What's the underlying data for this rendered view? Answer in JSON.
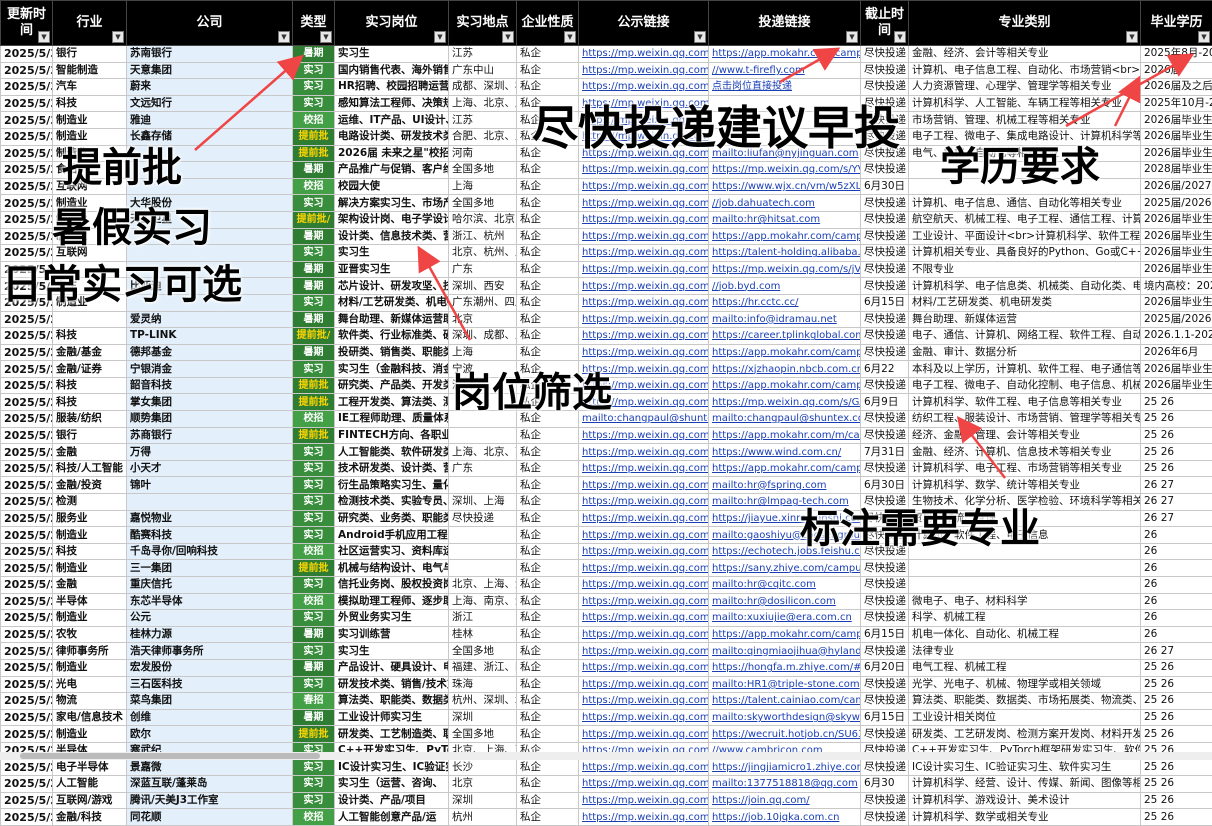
{
  "headers": [
    "更新时间",
    "行业",
    "公司",
    "类型",
    "实习岗位",
    "实习地点",
    "企业性质",
    "公示链接",
    "投递链接",
    "截止时间",
    "专业类别",
    "毕业学历"
  ],
  "colors": {
    "header_bg": "#000000",
    "type_bg": "#2e7d32",
    "tiqian_text": "#ffd600",
    "link": "#1a3fb5",
    "arrow": "#f04545"
  },
  "rows": [
    [
      "2025/5/30",
      "银行",
      "苏南银行",
      "暑期",
      "实习生",
      "江苏",
      "私企",
      "https://mp.weixin.qq.com/s/EK8",
      "https://app.mokahr.com/campus-r",
      "尽快投递",
      "金融、经济、会计等相关专业",
      "2025年8月-2026"
    ],
    [
      "2025/5/30",
      "智能制造",
      "天意集团",
      "实习",
      "国内销售代表、海外销售代",
      "广东中山",
      "私企",
      "https://mp.weixin.qq.com/s/zCO",
      "//www.t-firefly.com",
      "尽快投递",
      "计算机、电子信息工程、自动化、市场营销<br>平面设",
      "2026届"
    ],
    [
      "2025/5/30",
      "汽车",
      "蔚来",
      "实习",
      "HR招聘、校园招聘运营、盾",
      "成都、深圳、杭",
      "私企",
      "https://mp.weixin.qq.com/s/fpR",
      "点击岗位直接投递",
      "尽快投递",
      "人力资源管理、心理学、管理学等相关专业",
      "2026届及之后毕"
    ],
    [
      "2025/5/30",
      "科技",
      "文远知行",
      "实习",
      "感知算法工程师、决策规划算",
      "上海、北京、广",
      "私企",
      "https://mp.weixin.qq.com/s/sRtl",
      "",
      "尽快投递",
      "计算机科学、人工智能、车辆工程等相关专业",
      "2025年10月-2026"
    ],
    [
      "2025/5/30",
      "制造业",
      "雅迪",
      "校招",
      "运维、IT产品、UI设计、SAP",
      "江苏",
      "私企",
      "https://mp.weixin.qq.com/s/vt8C",
      "",
      "尽快投递",
      "市场营销、管理、机械工程等相关专业",
      "2026届毕业生"
    ],
    [
      "2025/5/30",
      "制造业",
      "长鑫存储",
      "提前批",
      "电路设计类、研发技术类、",
      "合肥、北京、上",
      "私企",
      "https://mp.weixin.qq.com/s/Qv2",
      "",
      "尽快投递",
      "电子工程、微电子、集成电路设计、计算机科学等相关专",
      "2026届毕业生"
    ],
    [
      "2025/5/30",
      "制造业",
      "",
      "提前批",
      "2026届 未来之星\"校招",
      "河南",
      "私企",
      "https://mp.weixin.qq.com/s/8",
      "mailto:liufan@nyjinguan.com",
      "尽快投递",
      "电气、机械、自动化等相关专业",
      "2026届毕业生"
    ],
    [
      "2025/5/30",
      "食品",
      "",
      "暑期",
      "产品推广与促销、客户维",
      "全国多地",
      "私企",
      "https://mp.weixin.qq.com/s/Y",
      "https://mp.weixin.qq.com/s/YVXEg",
      "尽快投递",
      "",
      "2028届毕业生"
    ],
    [
      "2025/5/30",
      "互联网",
      "",
      "校招",
      "校园大使",
      "上海",
      "私企",
      "https://mp.weixin.qq.com/s/",
      "https://www.wjx.cn/vm/w5zXLPj.as",
      "6月30日",
      "",
      "2026届/2027届"
    ],
    [
      "2025/5/30",
      "制造业",
      "大华股份",
      "实习",
      "解决方案实习生、市场产品实",
      "全国多地",
      "私企",
      "https://mp.weixin.qq.com/s/a",
      "//job.dahuatech.com",
      "尽快投递",
      "计算机、电子信息、通信、自动化等相关专业",
      "2025届/2026届"
    ],
    [
      "2025/5/30",
      "制造业",
      "天工卫星",
      "提前批/",
      "架构设计岗、电子学设计岗、",
      "哈尔滨、北京",
      "私企",
      "https://mp.weixin.qq.com/s/F",
      "mailto:hr@hitsat.com",
      "尽快投递",
      "航空航天、机械工程、电子工程、通信工程、计算机科学",
      "2026届毕业生"
    ],
    [
      "2025/5/30",
      "制造业",
      "",
      "暑期",
      "设计类、信息技术类、营销",
      "浙江、杭州",
      "私企",
      "https://mp.weixin.qq.com/s/F",
      "https://app.mokahr.com/campus-r",
      "尽快投递",
      "工业设计、平面设计<br>计算机科学、软件工程、电子信",
      "2026届毕业生"
    ],
    [
      "2025/5/29",
      "互联网",
      "",
      "实习",
      "实习生",
      "北京、杭州、上",
      "私企",
      "https://mp.weixin.qq.com/s/TBa",
      "https://talent-holding.alibaba.com/",
      "尽快投递",
      "计算机相关专业、具备良好的Python、Go或C++编程能",
      "2026届毕业生"
    ],
    [
      "2025/5/29",
      "",
      "",
      "暑期",
      "亚晋实习生",
      "广东",
      "私企",
      "https://mp.weixin.qq.com/s/jVzT",
      "https://mp.weixin.qq.com/s/jVzTEl4lG",
      "尽快投递",
      "不限专业",
      "2026届毕业生"
    ],
    [
      "2025/5/28",
      "汽车",
      "比亚迪",
      "暑期",
      "芯片设计、研发攻坚、技术支",
      "深圳、西安",
      "私企",
      "https://mp.weixin.qq.com/s/3bX",
      "//job.byd.com",
      "尽快投递",
      "计算机科学、电子信息类、机械类、自动化类、电气类等专",
      "境内高校：2024"
    ],
    [
      "2025/5/28",
      "制造业",
      "",
      "实习",
      "材料/工艺研发类、机电研发类",
      "广东潮州、四川",
      "私企",
      "https://mp.weixin.qq.com/s/Spd",
      "https://hr.cctc.cc/",
      "6月15日",
      "材料/工艺研发类、机电研发类",
      "2026届毕业生"
    ],
    [
      "2025/5/28",
      "",
      "爱灵纳",
      "暑期",
      "舞台助理、新媒体运营助理、",
      "北京",
      "私企",
      "https://mp.weixin.qq.com/s/DxV",
      "mailto:info@idramau.net",
      "尽快投递",
      "舞台助理、新媒体运营",
      "2025届/2026届毕"
    ],
    [
      "2025/5/27",
      "科技",
      "TP-LINK",
      "提前批/",
      "软件类、行业标准类、硬件",
      "深圳、成都、上",
      "私企",
      "https://mp.weixin.qq.com/s/Z",
      "https://career.tplinkglobal.com/ca",
      "尽快投递",
      "电子、通信、计算机、网络工程、软件工程、自动化等理",
      "2026.1.1-2026."
    ],
    [
      "2025/5/27",
      "金融/基金",
      "德邦基金",
      "暑期",
      "投研类、销售类、职能类",
      "上海",
      "私企",
      "https://mp.weixin.qq.com/s/i",
      "https://app.mokahr.com/campus-r",
      "尽快投递",
      "金融、审计、数据分析",
      "2026年6月"
    ],
    [
      "2025/5/27",
      "金融/证券",
      "宁银消金",
      "实习",
      "实习生（金融科技、消金定",
      "宁波",
      "私企",
      "https://mp.weixin.qq.com/s/P",
      "https://xjzhaopin.nbcb.com.cn",
      "6月22",
      "本科及以上学历，计算机、软件工程、电子通信等相关专",
      "2026届毕业生"
    ],
    [
      "2025/5/27",
      "科技",
      "韶音科技",
      "提前批",
      "研究类、产品类、开发类、工",
      "深圳",
      "私企",
      "https://mp.weixin.qq.com/s/r",
      "https://app.mokahr.com/campus-r",
      "尽快投递",
      "电子工程、微电子、自动化控制、电子信息、机械工程、",
      "2026届毕业生"
    ],
    [
      "2025/5/26",
      "科技",
      "掌女集团",
      "提前批",
      "工程开发类、算法类、测试",
      "",
      "私企",
      "https://mp.weixin.qq.com/s/GA",
      "https://mp.weixin.qq.com/s/GAWH24",
      "6月9日",
      "计算机科学、软件工程、电子信息等相关专业",
      "25 26"
    ],
    [
      "2025/5/26",
      "服装/纺织",
      "顺势集团",
      "校招",
      "IE工程师助理、质量体系助",
      "",
      "私企",
      "mailto:changpaul@shuntex.com",
      "mailto:changpaul@shuntex.com",
      "尽快投递",
      "纺织工程、服装设计、市场营销、管理学等相关专业",
      "25 26"
    ],
    [
      "2025/5/26",
      "银行",
      "苏商银行",
      "提前批",
      "FINTECH方向、各职业务方",
      "",
      "私企",
      "https://mp.weixin.qq.com/s/Rgz",
      "https://app.mokahr.com/m/campus-re",
      "尽快投递",
      "经济、金融、管理、会计等相关专业",
      "25 26"
    ],
    [
      "2025/5/26",
      "金融",
      "万得",
      "实习",
      "人工智能类、软件研发类、职",
      "上海、北京、苏",
      "私企",
      "https://mp.weixin.qq.com/s/7IVF",
      "https://www.wind.com.cn/",
      "7月31日",
      "金融、经济、计算机、信息技术等相关专业",
      "25 26"
    ],
    [
      "2025/5/26",
      "科技/人工智能",
      "小天才",
      "实习",
      "技术研发类、设计类、营销职",
      "广东",
      "私企",
      "https://mp.weixin.qq.com/s/tGH",
      "https://app.mokahr.com/campus-recr",
      "尽快投递",
      "计算机科学、电子工程、市场营销等相关专业",
      "25 26"
    ],
    [
      "2025/5/26",
      "金融/投资",
      "锦叶",
      "实习",
      "衍生品策略实习生、量化实",
      "",
      "私企",
      "https://mp.weixin.qq.com/s/KsF",
      "mailto:hr@fspring.com",
      "6月30日",
      "计算机科学、数学、统计等相关专业",
      "26 27"
    ],
    [
      "2025/5/26",
      "检测",
      "",
      "实习",
      "检测技术类、实验专员、分",
      "深圳、上海",
      "私企",
      "https://mp.weixin.qq.com/s/Hu",
      "mailto:hr@lmpag-tech.com",
      "尽快投递",
      "生物技术、化学分析、医学检验、环境科学等相关专业",
      "26 27"
    ],
    [
      "2025/5/26",
      "服务业",
      "嘉悦物业",
      "实习",
      "研究类、业务类、职能类",
      "尽快投递",
      "私企",
      "https://mp.weixin.qq.com/s/zYJI",
      "https://jiayue.xinrenxinshi.com/recrui",
      "尽快投递",
      "贸易、物流、管理",
      "26 27"
    ],
    [
      "2025/5/26",
      "制造业",
      "酷赛科技",
      "实习",
      "Android手机应用工程师、",
      "",
      "私企",
      "https://mp.weixin.qq.com/s/Cw",
      "mailto:gaoshiyu@cooseagroup.com",
      "尽快投递",
      "计算机、软件工程、电子信息",
      "26"
    ],
    [
      "2025/5/26",
      "科技",
      "千岛寻你/回响科技",
      "校招",
      "社区运营实习、资料库运营",
      "",
      "私企",
      "https://mp.weixin.qq.com/s/c5u",
      "https://echotech.jobs.feishu.cn/gland",
      "尽快投递",
      "",
      "26"
    ],
    [
      "2025/5/26",
      "制造业",
      "三一集团",
      "提前批",
      "机械与结构设计、电气与控",
      "",
      "私企",
      "https://mp.weixin.qq.com/s/Apa",
      "https://sany.zhiye.com/campus/jobs",
      "尽快投递",
      "",
      "26"
    ],
    [
      "2025/5/26",
      "金融",
      "重庆信托",
      "实习",
      "信托业务岗、股权投资岗、固",
      "北京、上海、深",
      "私企",
      "https://mp.weixin.qq.com/s/Cw0",
      "mailto:hr@cqitc.com",
      "尽快投递",
      "",
      "26"
    ],
    [
      "2025/5/26",
      "半导体",
      "东芯半导体",
      "校招",
      "模拟助理工程师、逐步助",
      "上海、南京、深",
      "私企",
      "https://mp.weixin.qq.com/s/fqso",
      "mailto:hr@dosilicon.com",
      "尽快投递",
      "微电子、电子、材料科学",
      "26"
    ],
    [
      "2025/5/26",
      "制造业",
      "公元",
      "实习",
      "外贸业务实习生",
      "浙江",
      "私企",
      "https://mp.weixin.qq.com/s/zqv",
      "mailto:xuxiujie@era.com.cn",
      "尽快投递",
      "科学、机械工程",
      "26"
    ],
    [
      "2025/5/26",
      "农牧",
      "桂林力源",
      "暑期",
      "实习训练营",
      "桂林",
      "私企",
      "https://mp.weixin.qq.com/s/WYt",
      "https://app.mokahr.com/campus-recr",
      "6月15日",
      "机电一体化、自动化、机械工程",
      "26"
    ],
    [
      "2025/5/26",
      "律师事务所",
      "浩天律师事务所",
      "实习",
      "实习生",
      "全国多地",
      "私企",
      "https://mp.weixin.qq.com/s/Cuk",
      "mailto:qingmiaojihua@hylandslaw.co",
      "尽快投递",
      "法律专业",
      "26 27"
    ],
    [
      "2025/5/26",
      "制造业",
      "宏发股份",
      "暑期",
      "产品设计、硬具设计、电气",
      "福建、浙江、四",
      "私企",
      "https://mp.weixin.qq.com/s/5A5",
      "https://hongfa.m.zhiye.com/#/jobs?jc",
      "6月20日",
      "电气工程、机械工程",
      "25 26"
    ],
    [
      "2025/5/23",
      "光电",
      "三石医科技",
      "实习",
      "研发技术类、销售/技术支持",
      "珠海",
      "私企",
      "https://mp.weixin.qq.com/s/1J9",
      "mailto:HR1@triple-stone.com",
      "尽快投递",
      "光学、光电子、机械、物理学或相关领域",
      "25 26"
    ],
    [
      "2025/5/23",
      "物流",
      "菜鸟集团",
      "春招",
      "算法类、职能类、数据类、市",
      "杭州、深圳、北",
      "私企",
      "https://mp.weixin.qq.com/s/rahf",
      "https://talent.cainiao.com/campus/recr",
      "尽快投递",
      "算法类、职能类、数据类、市场拓展类、物流类、研发",
      "25 26"
    ],
    [
      "2025/5/23",
      "家电/信息技术",
      "创维",
      "暑期",
      "工业设计师实习生",
      "深圳",
      "私企",
      "https://mp.weixin.qq.com/s/facH",
      "mailto:skyworthdesign@skyworth.com",
      "6月15日",
      "工业设计相关岗位",
      "25 26"
    ],
    [
      "2025/5/23",
      "制造业",
      "欧尔",
      "提前批",
      "研发类、工艺制造类、职能支",
      "全国多地",
      "私企",
      "https://mp.weixin.qq.com/s/twZ",
      "https://wecruit.hotjob.cn/SU63c50f8b0",
      "尽快投递",
      "研发类、工艺研发岗、检测方案开发岗、材料开发岗、应",
      "25 26"
    ],
    [
      "2025/5/23",
      "半导体",
      "寒武纪",
      "实习",
      "C++开发实习生、PyTorch框",
      "北京、上海、西",
      "私企",
      "https://mp.weixin.qq.com/s/jihl2",
      "//www.cambricon.com",
      "尽快投递",
      "C++开发实习生、PyTorch框架研发实习生、软件测试开",
      "25 26"
    ],
    [
      "2025/5/23",
      "电子半导体",
      "景嘉微",
      "实习",
      "IC设计实习生、IC验证实习",
      "长沙",
      "私企",
      "https://mp.weixin.qq.com/s/eaR",
      "https://jingjiamicro1.zhiye.com/?sess",
      "尽快投递",
      "IC设计实习生、IC验证实习生、软件实习生",
      "25 26"
    ],
    [
      "2025/5/22",
      "人工智能",
      "深蓝互联/蓬莱岛",
      "实习",
      "实习生（运营、咨询、",
      "北京",
      "私企",
      "https://mp.weixin.qq.com/s/7Av",
      "mailto:1377518818@qq.com",
      "6月30",
      "计算机科学、经营、设计、传媒、新闻、图像等相关专业",
      "25 26"
    ],
    [
      "2025/5/22",
      "互联网/游戏",
      "腾讯/天美J3工作室",
      "实习",
      "设计类、产品/项目",
      "深圳",
      "私企",
      "https://mp.weixin.qq.com/s/FmI",
      "https://join.qq.com/",
      "尽快投递",
      "计算机科学、游戏设计、美术设计",
      "25 26"
    ],
    [
      "2025/5/22",
      "金融/科技",
      "同花顺",
      "校招",
      "人工智能创意产品/运",
      "杭州",
      "私企",
      "https://mp.weixin.qq.com/s/nlvY",
      "https://job.10jqka.com.cn",
      "尽快投递",
      "计算机科学、数学或相关专业",
      "25 26"
    ]
  ],
  "annotations": {
    "tiqian": "提前批",
    "shujia": "暑假实习",
    "richang": "日常实习可选",
    "toudi": "尽快投递建议早投",
    "xueli": "学历要求",
    "gangwei": "岗位筛选",
    "zhuanye": "标注需要专业"
  }
}
